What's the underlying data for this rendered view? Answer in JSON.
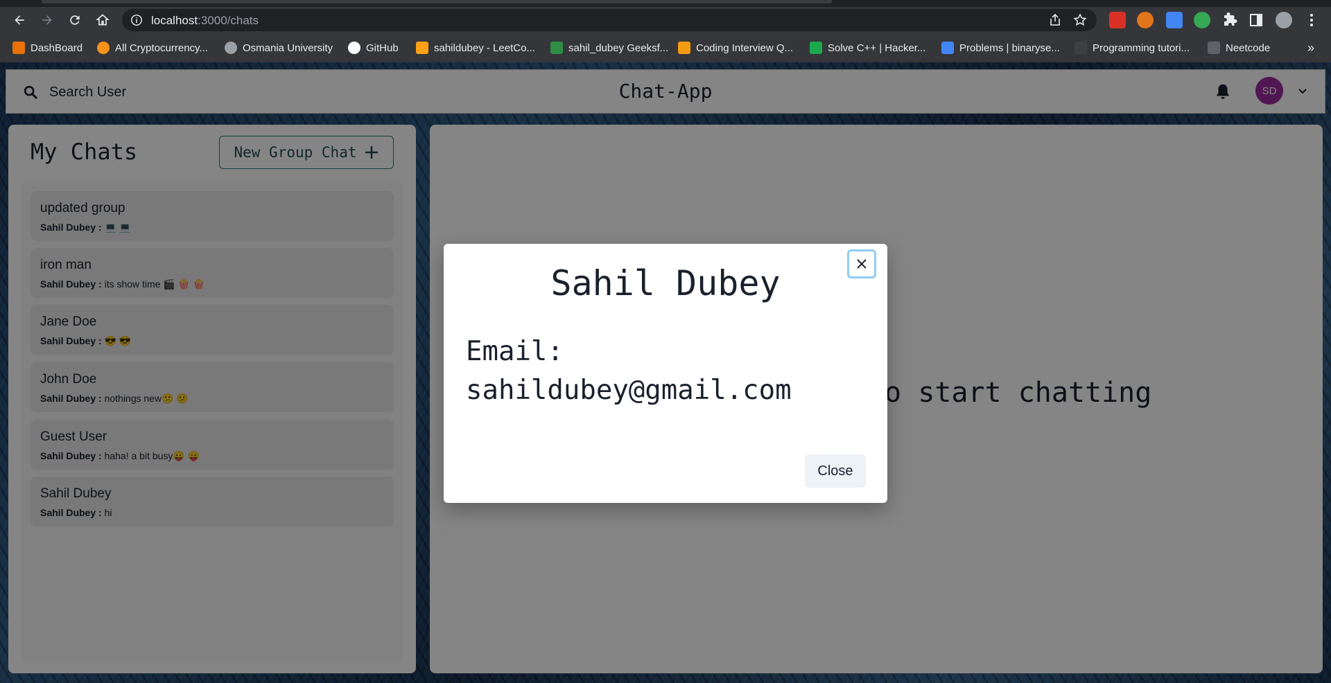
{
  "browser": {
    "url_host": "localhost",
    "url_path": ":3000/chats",
    "bookmarks": [
      {
        "label": "DashBoard",
        "color": "#e8710a"
      },
      {
        "label": "All Cryptocurrency...",
        "color": "#f7931a"
      },
      {
        "label": "Osmania University",
        "color": "#9aa0a6"
      },
      {
        "label": "GitHub",
        "color": "#ffffff"
      },
      {
        "label": "sahildubey - LeetCo...",
        "color": "#ffa116"
      },
      {
        "label": "sahil_dubey Geeksf...",
        "color": "#2f8d46"
      },
      {
        "label": "Coding Interview Q...",
        "color": "#f39c12"
      },
      {
        "label": "Solve C++ | Hacker...",
        "color": "#1ba94c"
      },
      {
        "label": "Problems | binaryse...",
        "color": "#4285f4"
      },
      {
        "label": "Programming tutori...",
        "color": "#3c4043"
      },
      {
        "label": "Neetcode",
        "color": "#9aa0a6"
      }
    ]
  },
  "header": {
    "search_label": "Search User",
    "title": "Chat-App",
    "avatar_initials": "SD"
  },
  "chats": {
    "title": "My Chats",
    "new_group_label": "New Group Chat",
    "items": [
      {
        "name": "updated group",
        "sender": "Sahil Dubey :",
        "message": " 💻 💻"
      },
      {
        "name": "iron man",
        "sender": "Sahil Dubey :",
        "message": " its show time 🎬 🍿 🍿"
      },
      {
        "name": "Jane Doe",
        "sender": "Sahil Dubey :",
        "message": " 😎 😎"
      },
      {
        "name": "John Doe",
        "sender": "Sahil Dubey :",
        "message": " nothings new😕 😕"
      },
      {
        "name": "Guest User",
        "sender": "Sahil Dubey :",
        "message": " haha! a bit busy😛 😛"
      },
      {
        "name": "Sahil Dubey",
        "sender": "Sahil Dubey :",
        "message": " hi"
      }
    ]
  },
  "chatbox": {
    "placeholder": "Click on a user to start chatting"
  },
  "modal": {
    "title": "Sahil Dubey",
    "email_label": "Email:",
    "email": "sahildubey@gmail.com",
    "close_label": "Close"
  },
  "colors": {
    "avatar": "#9b2c9e",
    "accent": "#2c7a7b",
    "focus_ring": "#90cdf4"
  }
}
